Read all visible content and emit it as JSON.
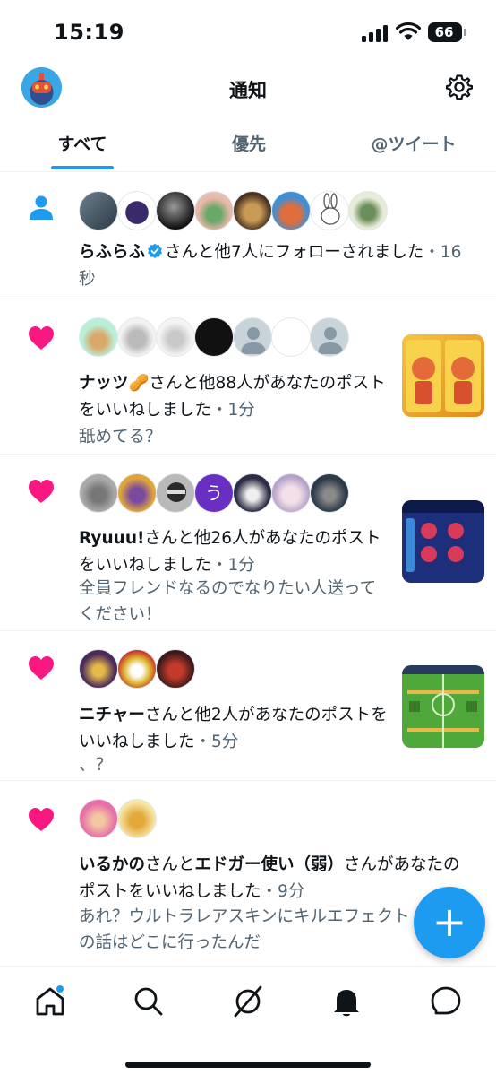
{
  "status_bar": {
    "time": "15:19",
    "battery": "66"
  },
  "header": {
    "title": "通知"
  },
  "tabs": [
    {
      "label": "すべて",
      "active": true
    },
    {
      "label": "優先",
      "active": false
    },
    {
      "label": "@ツイート",
      "active": false
    }
  ],
  "notifications": [
    {
      "type": "follow",
      "name": "らふらふ",
      "verified": true,
      "text": "さんと他7人にフォローされました",
      "time": "・16秒"
    },
    {
      "type": "like",
      "name": "ナッツ🥜",
      "text": "さんと他88人があなたのポストをいいねしました",
      "time": "・1分",
      "preview": "舐めてる？"
    },
    {
      "type": "like",
      "name": "Ryuuu!",
      "text": "さんと他26人があなたのポストをいいねしました",
      "time": "・1分",
      "preview": "全員フレンドなるのでなりたい人送ってください！",
      "avatar_letter": "う"
    },
    {
      "type": "like",
      "name": "ニチャー",
      "text": "さんと他2人があなたのポストをいいねしました",
      "time": "・5分",
      "preview": "、？"
    },
    {
      "type": "like",
      "name": "いるかの",
      "text_mid": "さんと",
      "name2": "エドガー使い（弱）",
      "text": "さんがあなたのポストをいいねしました",
      "time": "・9分",
      "preview": "あれ？ウルトラレアスキンにキルエフェクトの話はどこに行ったんだ"
    }
  ],
  "fab": {
    "label": "+"
  },
  "icons": {
    "follow": "person-icon",
    "like": "heart-icon",
    "settings": "gear-icon",
    "nav": [
      "home-icon",
      "search-icon",
      "grok-icon",
      "bell-icon",
      "messages-icon"
    ]
  },
  "colors": {
    "accent": "#1d9bf0",
    "like": "#f91880",
    "muted": "#536471"
  }
}
